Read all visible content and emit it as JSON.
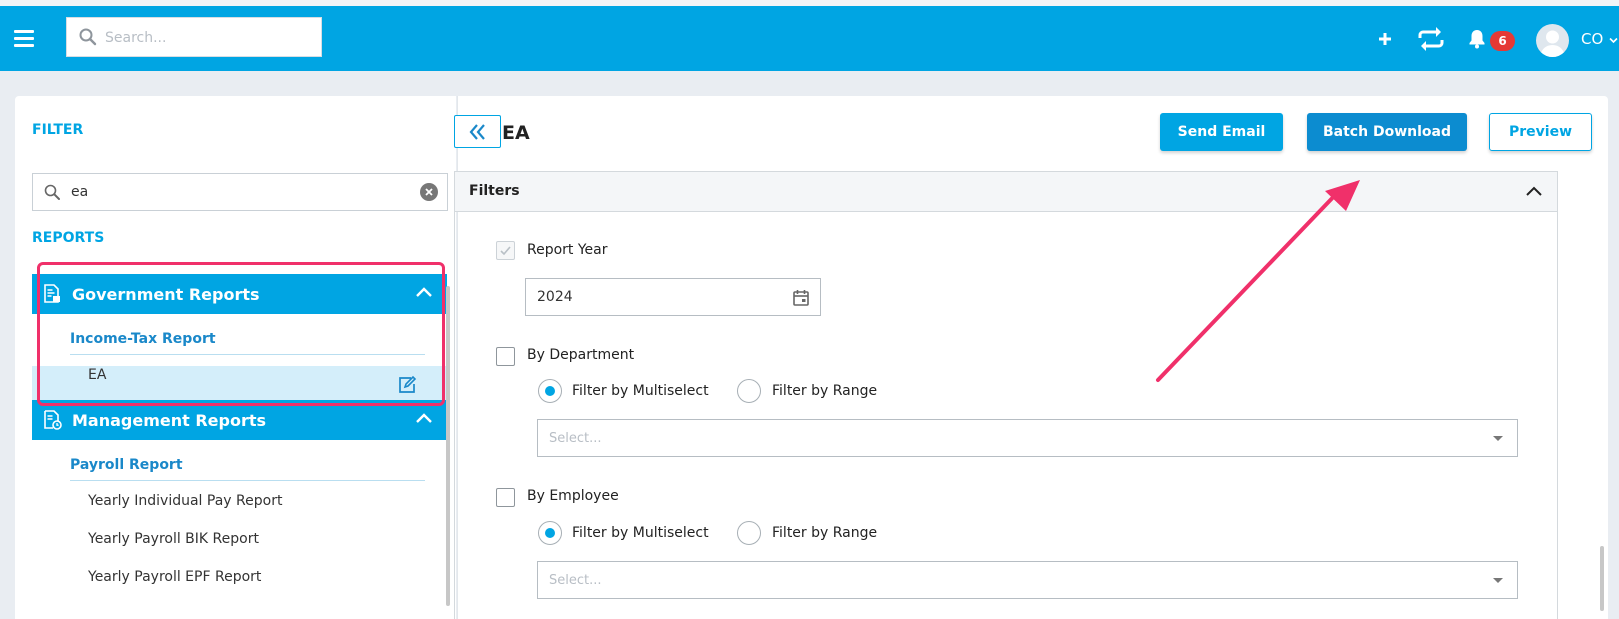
{
  "topbar": {
    "search_placeholder": "Search...",
    "notification_count": "6",
    "user_initials": "CO",
    "accent_color": "#00a5e3"
  },
  "sidebar": {
    "filter_label": "FILTER",
    "filter_value": "ea",
    "reports_label": "REPORTS",
    "groups": [
      {
        "label": "Government Reports",
        "icon": "report-doc-icon",
        "expanded": true,
        "subgroup": "Income-Tax Report",
        "items": [
          "EA"
        ]
      },
      {
        "label": "Management Reports",
        "icon": "report-clock-icon",
        "expanded": true,
        "subgroup": "Payroll Report",
        "items": [
          "Yearly Individual Pay Report",
          "Yearly Payroll BIK Report",
          "Yearly Payroll EPF Report"
        ]
      }
    ]
  },
  "main": {
    "title": "EA",
    "buttons": {
      "send_email": "Send Email",
      "batch_download": "Batch Download",
      "preview": "Preview"
    },
    "filters": {
      "header": "Filters",
      "report_year_label": "Report Year",
      "report_year_value": "2024",
      "by_department_label": "By Department",
      "by_employee_label": "By Employee",
      "filter_multiselect": "Filter by Multiselect",
      "filter_range": "Filter by Range",
      "select_placeholder": "Select..."
    }
  }
}
